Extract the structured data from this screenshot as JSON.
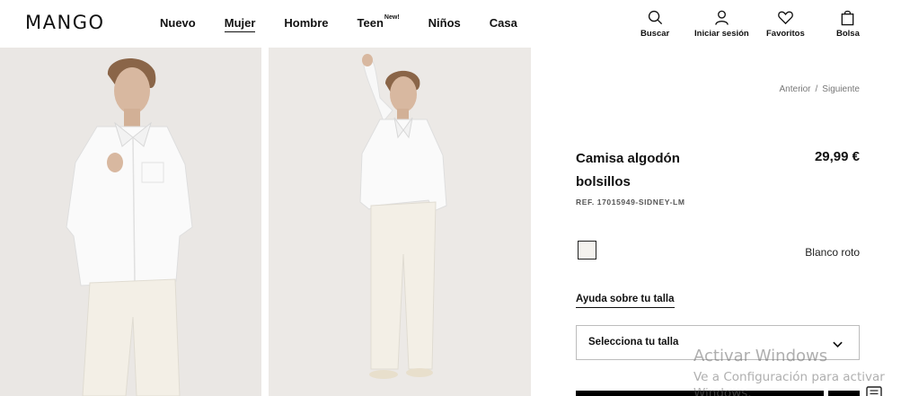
{
  "header": {
    "logo": "MANGO",
    "nav": [
      {
        "label": "Nuevo",
        "active": false
      },
      {
        "label": "Mujer",
        "active": true
      },
      {
        "label": "Hombre",
        "active": false
      },
      {
        "label": "Teen",
        "badge": "New!",
        "active": false
      },
      {
        "label": "Niños",
        "active": false
      },
      {
        "label": "Casa",
        "active": false
      }
    ],
    "tools": {
      "search": "Buscar",
      "login": "Iniciar sesión",
      "favorites": "Favoritos",
      "bag": "Bolsa"
    }
  },
  "product": {
    "breadcrumb_prev": "Anterior",
    "breadcrumb_sep": "/",
    "breadcrumb_next": "Siguiente",
    "title": "Camisa algodón bolsillos",
    "price": "29,99 €",
    "ref": "REF. 17015949-SIDNEY-LM",
    "color_name": "Blanco roto",
    "size_help": "Ayuda sobre tu talla",
    "size_select": "Selecciona tu talla"
  },
  "watermark": {
    "line1": "Activar Windows",
    "line2": "Ve a Configuración para activar",
    "line3": "Windows."
  },
  "colors": {
    "accent": "#000000",
    "swatch": "#f4f2ee",
    "photo_bg": "#eae7e4"
  }
}
